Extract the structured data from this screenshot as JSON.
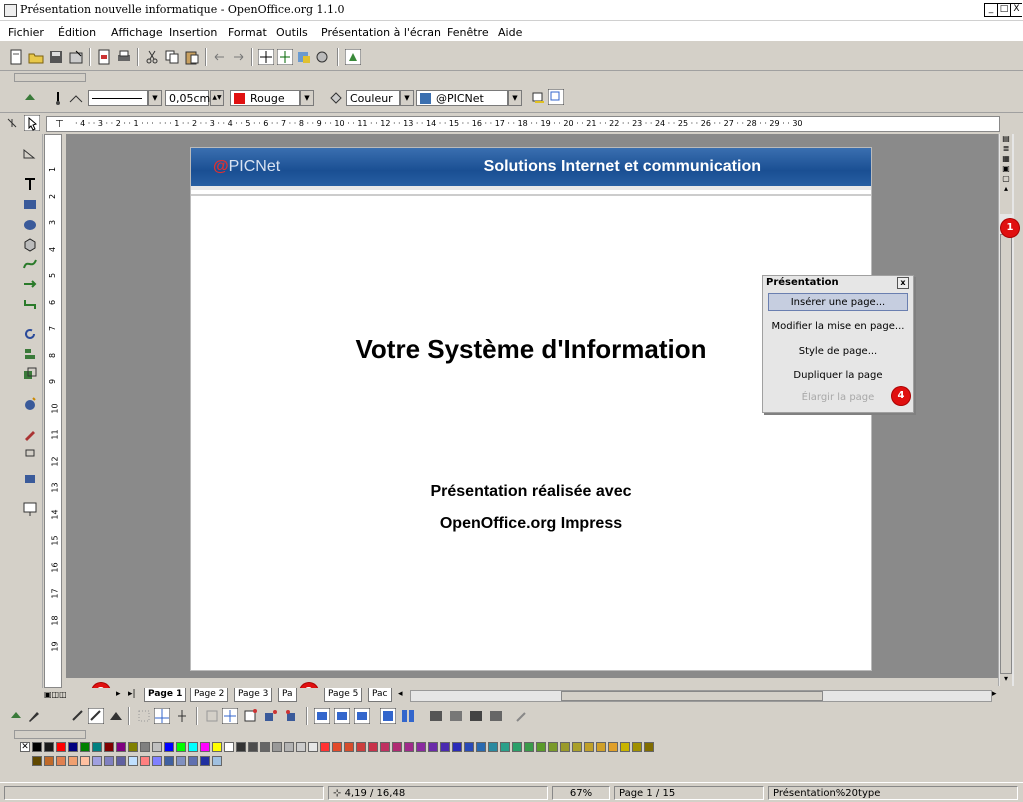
{
  "window": {
    "title": "Présentation nouvelle informatique - OpenOffice.org 1.1.0",
    "controls": [
      "_",
      "□",
      "X"
    ]
  },
  "menubar": [
    "Fichier",
    "Édition",
    "Affichage",
    "Insertion",
    "Format",
    "Outils",
    "Présentation à l'écran",
    "Fenêtre",
    "Aide"
  ],
  "format_toolbar": {
    "line_width": "0,05cm",
    "line_color": "Rouge",
    "line_color_hex": "#e01010",
    "area_style": "Couleur",
    "area_fill": "@PICNet",
    "area_fill_hex": "#3a6fb0"
  },
  "ruler": {
    "horizontal": "· 4 · · 3 · · 2 · · 1 · · ·  · · · 1 · · 2 · · 3 · · 4 · · 5 · · 6 · · 7 · · 8 · · 9 · · 10 · · 11 · · 12 · · 13 · · 14 · · 15 · · 16 · · 17 · · 18 · · 19 · · 20 · · 21 · · 22 · · 23 · · 24 · · 25 · · 26 · · 27 · · 28 · · 29 · · 30",
    "vertical": [
      "1",
      "2",
      "3",
      "4",
      "5",
      "6",
      "7",
      "8",
      "9",
      "10",
      "11",
      "12",
      "13",
      "14",
      "15",
      "16",
      "17",
      "18",
      "19"
    ]
  },
  "slide": {
    "logo_at": "@",
    "logo_text": "PICNet",
    "banner_title": "Solutions Internet et communication",
    "title": "Votre Système d'Information",
    "subtitle_1": "Présentation réalisée avec",
    "subtitle_2": "OpenOffice.org Impress"
  },
  "context_menu": {
    "title": "Présentation",
    "close": "x",
    "items": [
      {
        "label": "Insérer une page...",
        "state": "selected"
      },
      {
        "label": "Modifier la mise en page...",
        "state": "normal"
      },
      {
        "label": "Style de page...",
        "state": "normal"
      },
      {
        "label": "Dupliquer la page",
        "state": "normal"
      },
      {
        "label": "Élargir la page",
        "state": "disabled"
      }
    ]
  },
  "callouts": [
    "1",
    "2",
    "3",
    "4"
  ],
  "page_tabs": [
    "Page 1",
    "Page 2",
    "Page 3",
    "Pa",
    "Page 5",
    "Pac"
  ],
  "statusbar": {
    "position": "4,19 / 16,48",
    "zoom": "67%",
    "page": "Page 1 / 15",
    "layout": "Présentation%20type"
  },
  "palette_colors": [
    "#000000",
    "#1a1a1a",
    "#ff0000",
    "#000080",
    "#008000",
    "#008080",
    "#800000",
    "#800080",
    "#808000",
    "#808080",
    "#c0c0c0",
    "#0000ff",
    "#00ff00",
    "#00ffff",
    "#ff00ff",
    "#ffff00",
    "#ffffff",
    "#333333",
    "#4d4d4d",
    "#666666",
    "#999999",
    "#b3b3b3",
    "#cccccc",
    "#e6e6e6",
    "#ff3333",
    "#e34a2a",
    "#d64d2c",
    "#cc3e3e",
    "#c8324a",
    "#c03060",
    "#b02a72",
    "#a02a8a",
    "#8a2aa0",
    "#6a2aaa",
    "#4a2ab0",
    "#2a2ab8",
    "#2a4ab8",
    "#2a6ab0",
    "#2a8aa0",
    "#2aa08a",
    "#2aa06a",
    "#3a9a4a",
    "#5a9a2a",
    "#7a9a2a",
    "#9a9a2a",
    "#aaa02a",
    "#c0a02a",
    "#d0a02a",
    "#e0a02a",
    "#c8b400",
    "#a09000",
    "#806c00",
    "#604800",
    "#c06a2a",
    "#e08050",
    "#f0a070",
    "#ffc0a0",
    "#a0a0e0",
    "#8080c0",
    "#6060a0",
    "#c0e0ff",
    "#ff8080",
    "#8080ff",
    "#4060a0",
    "#8090c0",
    "#6070b0",
    "#2030a0",
    "#a0c0e0"
  ]
}
